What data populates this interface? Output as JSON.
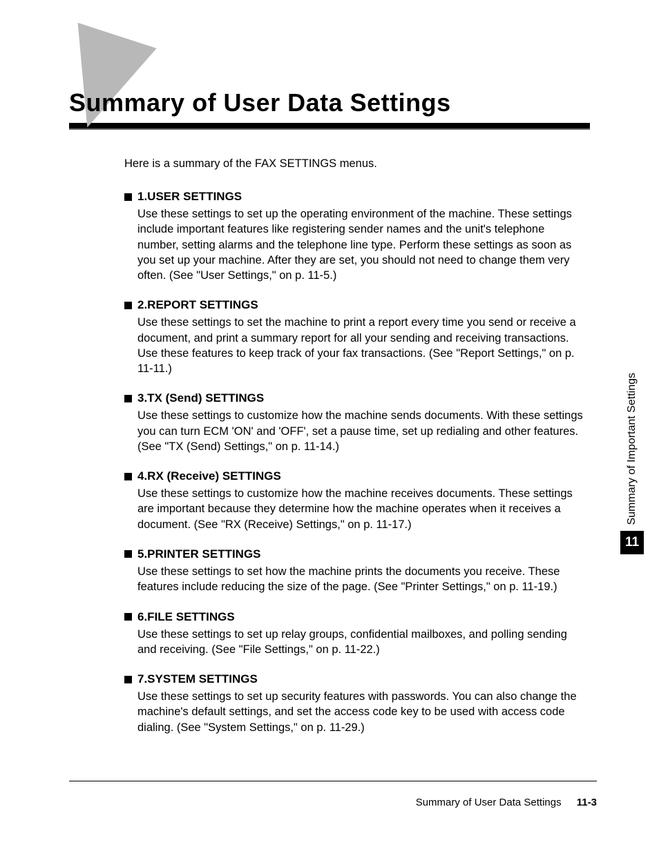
{
  "title": "Summary of User Data Settings",
  "intro": "Here is a summary of the FAX SETTINGS menus.",
  "sections": [
    {
      "heading": "1.USER SETTINGS",
      "body": "Use these settings to set up the operating environment of the machine. These settings include important features like registering sender names and the unit's telephone number, setting alarms and the telephone line type. Perform these settings as soon as you set up your machine. After they are set, you should not need to change them very often. (See \"User Settings,\" on p. 11-5.)"
    },
    {
      "heading": "2.REPORT SETTINGS",
      "body": "Use these settings to set the machine to print a report every time you send or receive a document, and print a summary report for all your sending and receiving transactions. Use these features to keep track of your fax transactions. (See \"Report Settings,\" on p. 11-11.)"
    },
    {
      "heading": "3.TX (Send) SETTINGS",
      "body": "Use these settings to customize how the machine sends documents. With these settings you can turn ECM 'ON' and 'OFF', set a pause time, set up redialing and other features. (See \"TX (Send) Settings,\" on p. 11-14.)"
    },
    {
      "heading": "4.RX (Receive) SETTINGS",
      "body": "Use these settings to customize how the machine receives documents. These settings are important because they determine how the machine operates when it receives a document. (See \"RX (Receive) Settings,\" on p. 11-17.)"
    },
    {
      "heading": "5.PRINTER SETTINGS",
      "body": "Use these settings to set how the machine prints the documents you receive. These features include reducing the size of the page. (See \"Printer Settings,\" on p. 11-19.)"
    },
    {
      "heading": "6.FILE SETTINGS",
      "body": "Use these settings to set up relay groups, confidential mailboxes, and polling sending and receiving. (See \"File Settings,\" on p. 11-22.)"
    },
    {
      "heading": "7.SYSTEM SETTINGS",
      "body": "Use these settings to set up security features with passwords. You can also change the machine's default settings, and set the access code key to be used with access code dialing. (See \"System Settings,\" on p. 11-29.)"
    }
  ],
  "sideTab": {
    "label": "Summary of Important Settings",
    "chapter": "11"
  },
  "footer": {
    "label": "Summary of User Data Settings",
    "page": "11-3"
  }
}
